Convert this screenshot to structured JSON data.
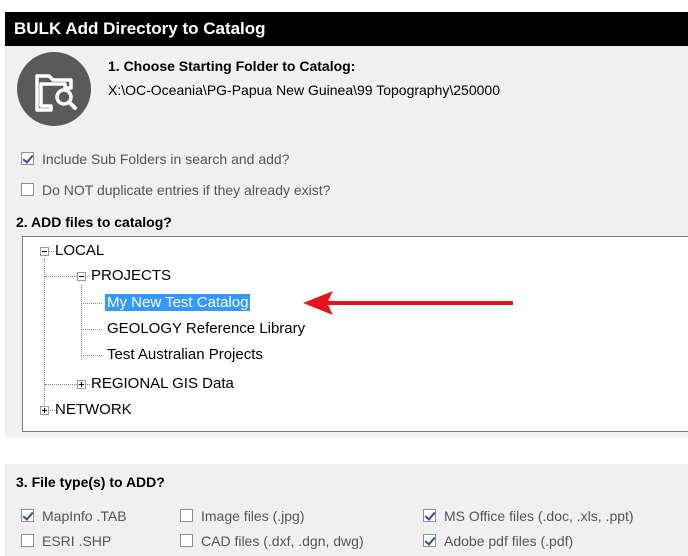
{
  "window": {
    "title": "BULK Add Directory to Catalog"
  },
  "step1": {
    "title": "1. Choose Starting Folder to Catalog:",
    "path": "X:\\OC-Oceania\\PG-Papua New Guinea\\99 Topography\\250000",
    "icon": "folder-search-icon"
  },
  "options": [
    {
      "label": "Include Sub Folders in search and add?",
      "checked": true
    },
    {
      "label": "Do NOT duplicate entries if they already exist?",
      "checked": false
    }
  ],
  "step2": {
    "title": "2. ADD files to catalog?",
    "tree": {
      "local": "LOCAL",
      "projects": "PROJECTS",
      "my_new": "My New Test Catalog",
      "geology": "GEOLOGY Reference Library",
      "test_aus": "Test Australian Projects",
      "regional": "REGIONAL GIS Data",
      "network": "NETWORK"
    },
    "selected": "My New Test Catalog",
    "annotation_color": "#e8131b"
  },
  "step3": {
    "title": "3. File type(s) to ADD?",
    "types": [
      {
        "label": "MapInfo .TAB",
        "checked": true
      },
      {
        "label": "Image files (.jpg)",
        "checked": false
      },
      {
        "label": "MS Office files (.doc, .xls, .ppt)",
        "checked": true
      },
      {
        "label": "ESRI .SHP",
        "checked": false
      },
      {
        "label": "CAD files (.dxf, .dgn, dwg)",
        "checked": false
      },
      {
        "label": "Adobe pdf files (.pdf)",
        "checked": true
      }
    ]
  },
  "colors": {
    "selection": "#3399ff",
    "checkmark": "#2a4f9c",
    "arrow": "#e8131b"
  }
}
